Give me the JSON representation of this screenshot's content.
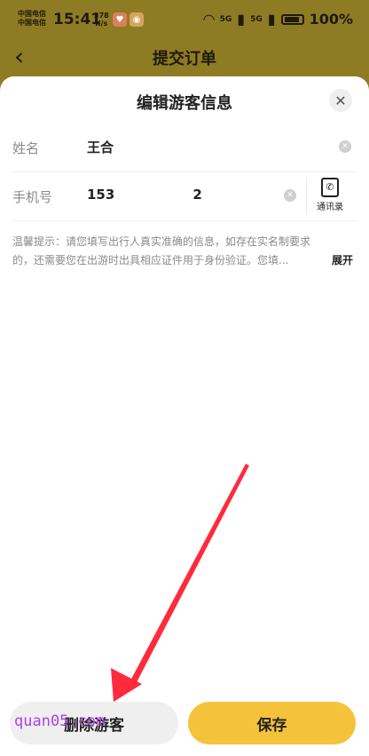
{
  "status_bar": {
    "carrier1": "中国电信",
    "carrier2": "中国电信",
    "time": "15:41",
    "net_speed_value": "378",
    "net_speed_unit": "K/s",
    "signal1": "5G",
    "signal2": "5G",
    "battery": "100%"
  },
  "background_page": {
    "title": "提交订单"
  },
  "sheet": {
    "title": "编辑游客信息",
    "fields": {
      "name_label": "姓名",
      "name_value": "王合",
      "phone_label": "手机号",
      "phone_value_prefix": "153",
      "phone_value_suffix": "2"
    },
    "contacts_label": "通讯录",
    "tip": "温馨提示：请您填写出行人真实准确的信息，如存在实名制要求的，还需要您在出游时出具相应证件用于身份验证。您填...",
    "expand_label": "展开",
    "delete_label": "删除游客",
    "save_label": "保存",
    "watermark": "quan05.com"
  },
  "colors": {
    "accent": "#f5c33b",
    "annotation_arrow": "#ff2b3c"
  }
}
